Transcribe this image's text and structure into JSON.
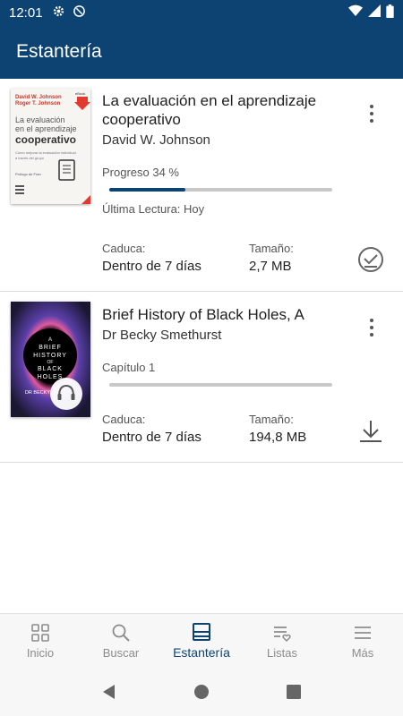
{
  "status_bar": {
    "time": "12:01",
    "icons": [
      "gear-icon",
      "at-icon",
      "wifi-icon",
      "signal-icon",
      "battery-icon"
    ]
  },
  "app_bar": {
    "title": "Estantería"
  },
  "books": [
    {
      "title": "La evaluación en el aprendizaje cooperativo",
      "author": "David W. Johnson",
      "status_text": "Progreso 34 %",
      "progress": 0.34,
      "last_read": "Última Lectura: Hoy",
      "expires_label": "Caduca:",
      "expires_value": "Dentro de 7 días",
      "size_label": "Tamaño:",
      "size_value": "2,7 MB",
      "action_icon": "downloaded-check-icon",
      "cover": {
        "authors": "David W. Johnson\nRoger T. Johnson",
        "badge": "eBook",
        "title_line1": "La evaluación",
        "title_line2": "en el aprendizaje",
        "title_line3": "cooperativo",
        "subtitle": "Cómo mejorar la evaluación individual a través del grupo",
        "prologue": "Prólogo de Fran"
      }
    },
    {
      "title": "Brief History of Black Holes, A",
      "author": "Dr Becky Smethurst",
      "status_text": "Capítulo 1",
      "progress": 0,
      "expires_label": "Caduca:",
      "expires_value": "Dentro de 7 días",
      "size_label": "Tamaño:",
      "size_value": "194,8 MB",
      "action_icon": "download-icon",
      "cover": {
        "title": "A BRIEF HISTORY OF BLACK HOLES",
        "author": "DR BECKY",
        "badge_icon": "headphones-icon"
      }
    }
  ],
  "bottom_nav": {
    "items": [
      {
        "label": "Inicio",
        "icon": "grid-icon"
      },
      {
        "label": "Buscar",
        "icon": "search-icon"
      },
      {
        "label": "Estantería",
        "icon": "shelf-icon"
      },
      {
        "label": "Listas",
        "icon": "list-heart-icon"
      },
      {
        "label": "Más",
        "icon": "menu-icon"
      }
    ],
    "active": "Estantería"
  },
  "system_nav": {
    "icons": [
      "back-icon",
      "home-icon",
      "recents-icon"
    ]
  },
  "colors": {
    "primary": "#0d4372",
    "progress_track": "#c8c8c8",
    "inactive_nav": "#8c8c8c",
    "cover_red": "#e23a2f"
  }
}
